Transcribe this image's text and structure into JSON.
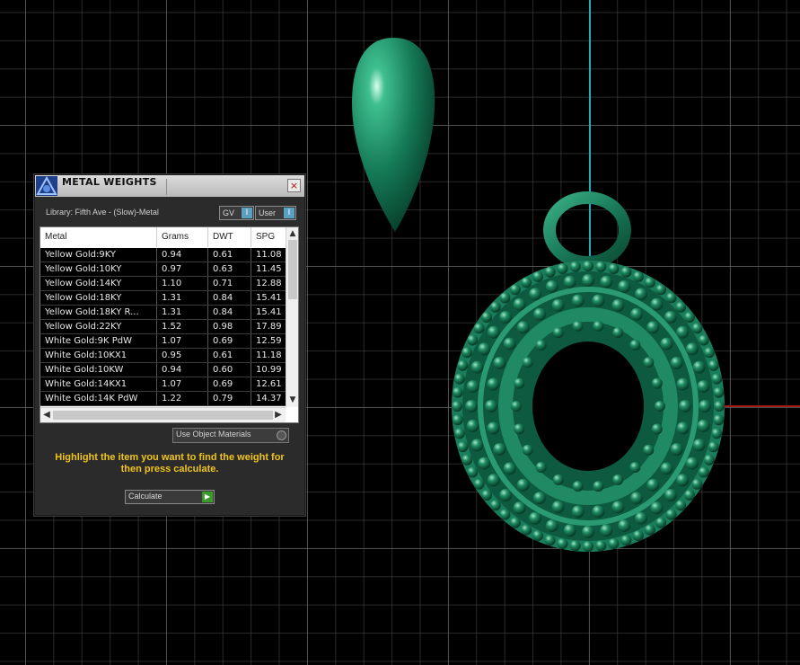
{
  "panel": {
    "title": "METAL WEIGHTS",
    "close_label": "×",
    "library_label": "Library: Fifth Ave - (Slow)-Metal",
    "gv_toggle": "GV",
    "user_toggle": "User",
    "toggle_mark": "I",
    "use_object_materials": "Use Object Materials",
    "instruction": "Highlight the item you want to find the weight for then press calculate.",
    "calculate_label": "Calculate",
    "calculate_icon": "play-icon"
  },
  "table": {
    "columns": [
      "Metal",
      "Grams",
      "DWT",
      "SPG"
    ],
    "rows": [
      [
        "Yellow Gold:9KY",
        "0.94",
        "0.61",
        "11.08"
      ],
      [
        "Yellow Gold:10KY",
        "0.97",
        "0.63",
        "11.45"
      ],
      [
        "Yellow Gold:14KY",
        "1.10",
        "0.71",
        "12.88"
      ],
      [
        "Yellow Gold:18KY",
        "1.31",
        "0.84",
        "15.41"
      ],
      [
        "Yellow Gold:18KY R...",
        "1.31",
        "0.84",
        "15.41"
      ],
      [
        "Yellow Gold:22KY",
        "1.52",
        "0.98",
        "17.89"
      ],
      [
        "White Gold:9K PdW",
        "1.07",
        "0.69",
        "12.59"
      ],
      [
        "White Gold:10KX1",
        "0.95",
        "0.61",
        "11.18"
      ],
      [
        "White Gold:10KW",
        "0.94",
        "0.60",
        "10.99"
      ],
      [
        "White Gold:14KX1",
        "1.07",
        "0.69",
        "12.61"
      ],
      [
        "White Gold:14K PdW",
        "1.22",
        "0.79",
        "14.37"
      ]
    ]
  },
  "colors": {
    "model_green": "#1f8c6a",
    "axis_y": "#2aa7b8",
    "axis_x": "#a11a12",
    "instruction_text": "#f0c419"
  }
}
